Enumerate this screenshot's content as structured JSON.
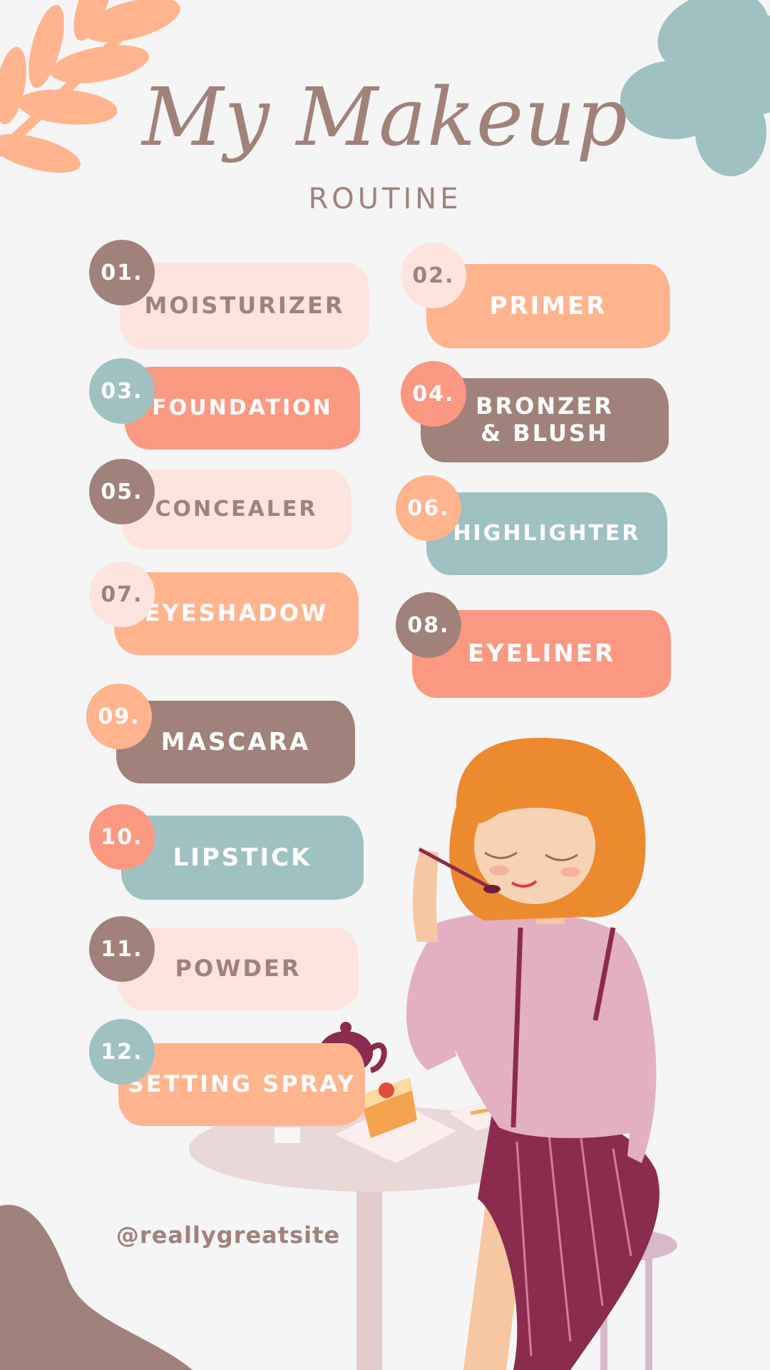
{
  "header": {
    "title": "My Makeup",
    "subtitle": "ROUTINE"
  },
  "steps": [
    {
      "number": "01.",
      "label": "MOISTURIZER"
    },
    {
      "number": "02.",
      "label": "PRIMER"
    },
    {
      "number": "03.",
      "label": "FOUNDATION"
    },
    {
      "number": "04.",
      "label": "BRONZER & BLUSH"
    },
    {
      "number": "05.",
      "label": "CONCEALER"
    },
    {
      "number": "06.",
      "label": "HIGHLIGHTER"
    },
    {
      "number": "07.",
      "label": "EYESHADOW"
    },
    {
      "number": "08.",
      "label": "EYELINER"
    },
    {
      "number": "09.",
      "label": "MASCARA"
    },
    {
      "number": "10.",
      "label": "LIPSTICK"
    },
    {
      "number": "11.",
      "label": "POWDER"
    },
    {
      "number": "12.",
      "label": "SETTING SPRAY"
    }
  ],
  "footer": {
    "handle": "@reallygreatsite"
  },
  "colors": {
    "background": "#f5f5f6",
    "brown": "#a1827b",
    "blush": "#fde4de",
    "peach": "#ffb48e",
    "coral": "#fb9882",
    "teal": "#9fc1c2"
  }
}
